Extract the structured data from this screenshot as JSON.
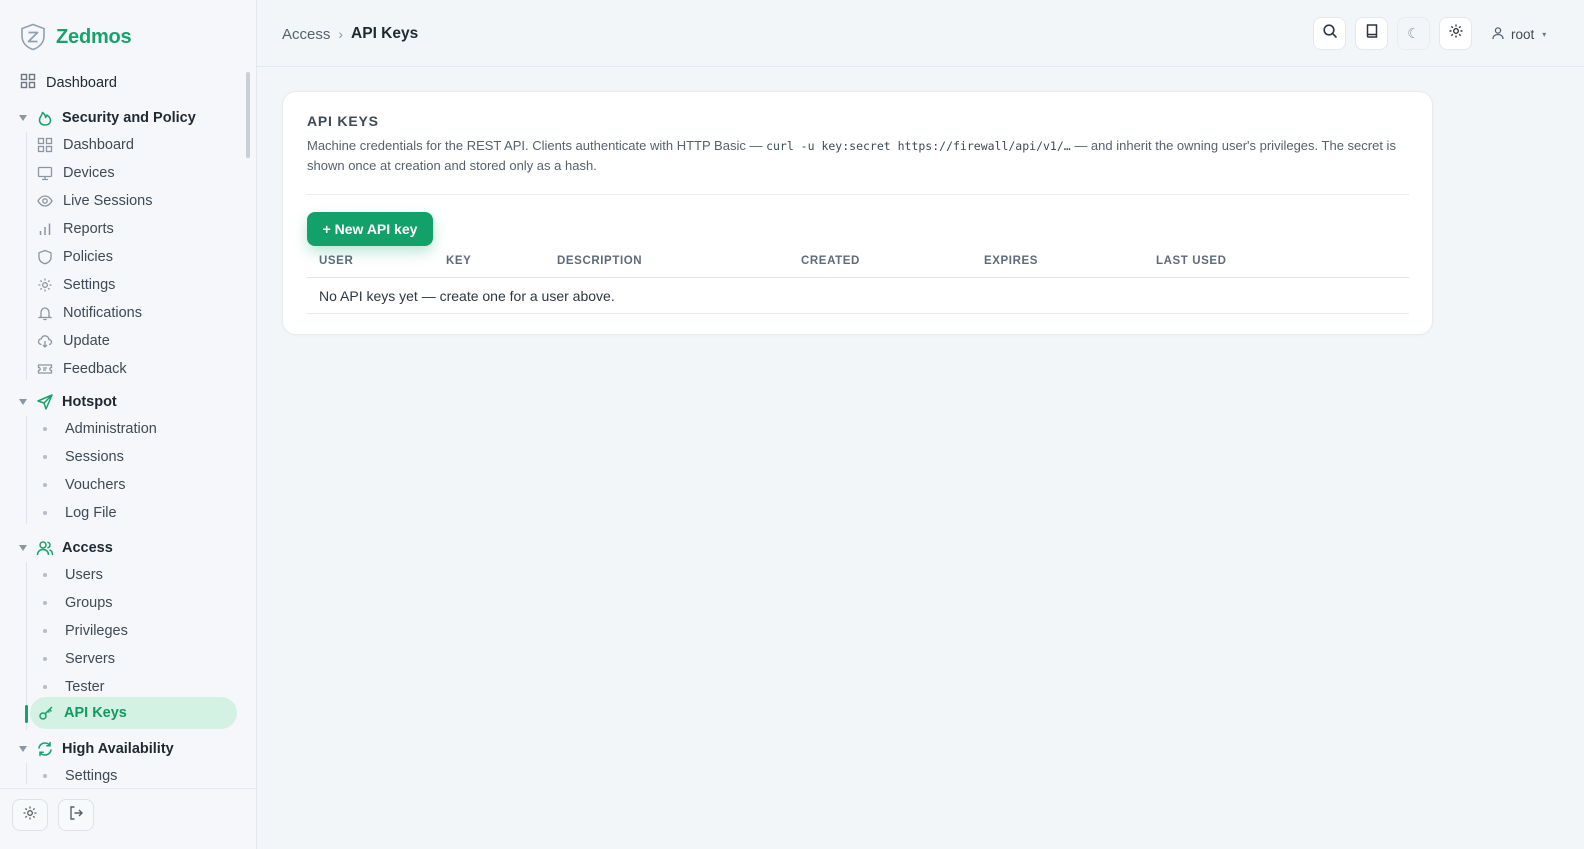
{
  "app": {
    "brand_name": "Zedmos"
  },
  "colors": {
    "accent": "#16a36a",
    "active_bg": "#d4f2e3"
  },
  "sidebar": {
    "top_item": {
      "label": "Dashboard",
      "icon": "dashboard-grid-icon"
    },
    "sections": [
      {
        "label": "Security and Policy",
        "icon": "flame-icon",
        "items": [
          {
            "label": "Dashboard",
            "icon": "dashboard-grid-icon"
          },
          {
            "label": "Devices",
            "icon": "monitor-icon"
          },
          {
            "label": "Live Sessions",
            "icon": "eye-icon"
          },
          {
            "label": "Reports",
            "icon": "bar-chart-icon"
          },
          {
            "label": "Policies",
            "icon": "shield-icon"
          },
          {
            "label": "Settings",
            "icon": "gear-icon"
          },
          {
            "label": "Notifications",
            "icon": "bell-icon"
          },
          {
            "label": "Update",
            "icon": "cloud-download-icon"
          },
          {
            "label": "Feedback",
            "icon": "ticket-icon"
          }
        ]
      },
      {
        "label": "Hotspot",
        "icon": "send-icon",
        "items": [
          {
            "label": "Administration"
          },
          {
            "label": "Sessions"
          },
          {
            "label": "Vouchers"
          },
          {
            "label": "Log File"
          }
        ]
      },
      {
        "label": "Access",
        "icon": "users-icon",
        "items": [
          {
            "label": "Users"
          },
          {
            "label": "Groups"
          },
          {
            "label": "Privileges"
          },
          {
            "label": "Servers"
          },
          {
            "label": "Tester"
          },
          {
            "label": "API Keys",
            "icon": "key-icon",
            "active": true
          }
        ]
      },
      {
        "label": "High Availability",
        "icon": "refresh-icon",
        "items": [
          {
            "label": "Settings"
          }
        ]
      }
    ],
    "footer": {
      "settings_icon": "gear-icon",
      "logout_icon": "logout-icon"
    }
  },
  "header": {
    "breadcrumb": {
      "parent": "Access",
      "separator": "›",
      "current": "API Keys"
    },
    "tools": [
      "search-icon",
      "book-icon",
      "moon-icon",
      "gear-icon"
    ],
    "moon_glyph": "☾",
    "user": {
      "name": "root",
      "caret": "▾"
    }
  },
  "card": {
    "title": "API KEYS",
    "desc_before": "Machine credentials for the REST API. Clients authenticate with HTTP Basic — ",
    "desc_code": "curl -u key:secret https://firewall/api/v1/…",
    "desc_after": " — and inherit the owning user's privileges. The secret is shown once at creation and stored only as a hash.",
    "new_button": "+ New API key",
    "table": {
      "columns": [
        "USER",
        "KEY",
        "DESCRIPTION",
        "CREATED",
        "EXPIRES",
        "LAST USED"
      ],
      "empty_message": "No API keys yet — create one for a user above."
    }
  }
}
